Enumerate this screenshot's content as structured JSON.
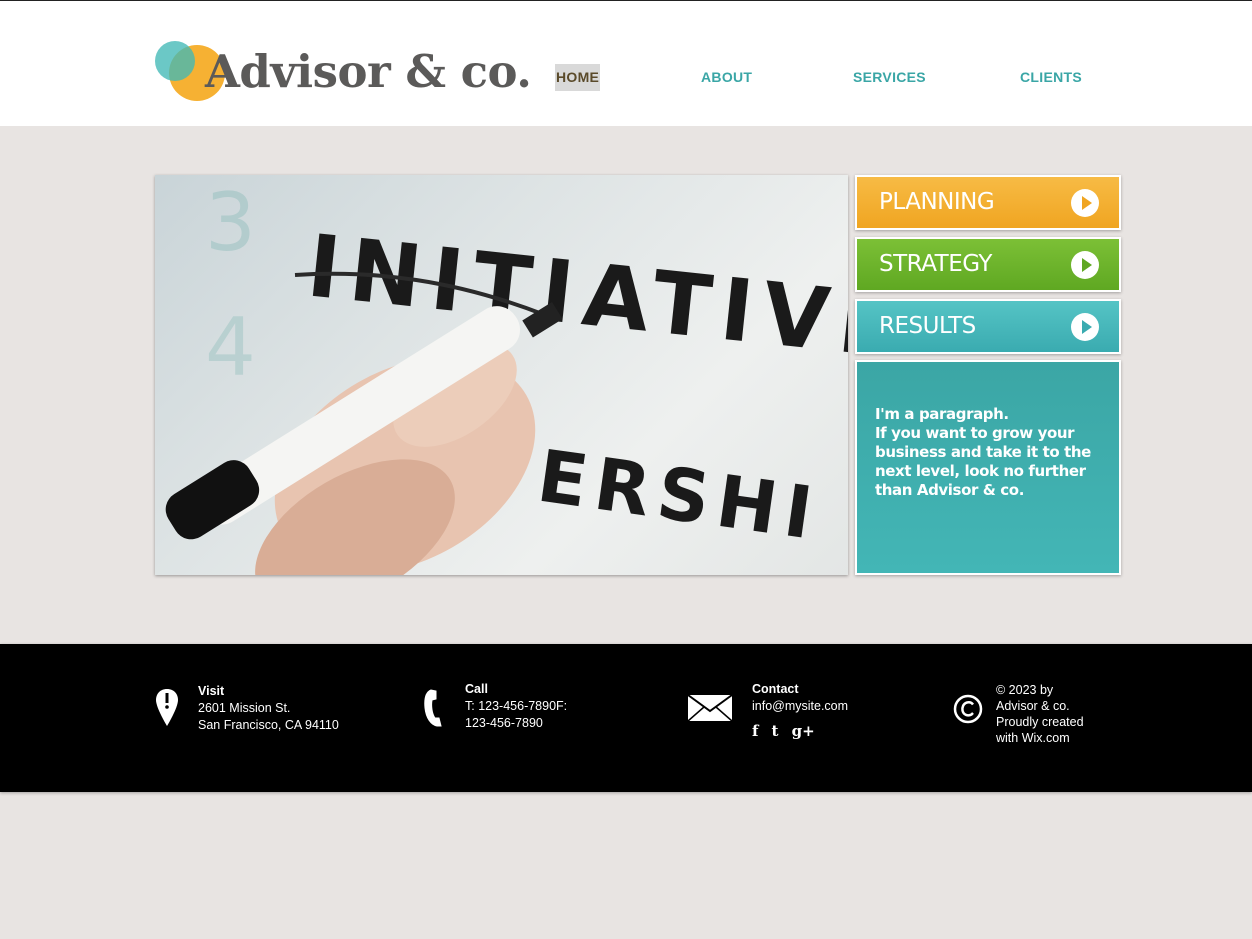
{
  "brand": {
    "name": "Advisor & co."
  },
  "nav": {
    "home": "HOME",
    "about": "ABOUT",
    "services": "SERVICES",
    "clients": "CLIENTS"
  },
  "hero": {
    "image_text": "INITIATIVE",
    "image_text_2": "ERSHI"
  },
  "actions": {
    "planning": "PLANNING",
    "strategy": "STRATEGY",
    "results": "RESULTS"
  },
  "info": {
    "line1": "I'm a paragraph.",
    "line2": "If you want to grow your business and take it to the next level, look no further than Advisor & co."
  },
  "footer": {
    "visit": {
      "heading": "Visit",
      "line1": "2601 Mission St.",
      "line2": "San Francisco, CA 94110"
    },
    "call": {
      "heading": "Call",
      "line1": "T: 123-456-7890F:",
      "line2": "123-456-7890"
    },
    "contact": {
      "heading": "Contact",
      "email": "info@mysite.com"
    },
    "copyright": {
      "line1": "© 2023 by",
      "line2": "Advisor & co.",
      "line3": "Proudly created",
      "line4": "with Wix.com"
    }
  },
  "social": {
    "facebook": "f",
    "twitter": "t",
    "google": "g+"
  },
  "colors": {
    "orange": "#f0a521",
    "green": "#5fa822",
    "teal": "#3aabb0",
    "nav_text": "#3aa6a6",
    "background": "#e8e4e2"
  }
}
